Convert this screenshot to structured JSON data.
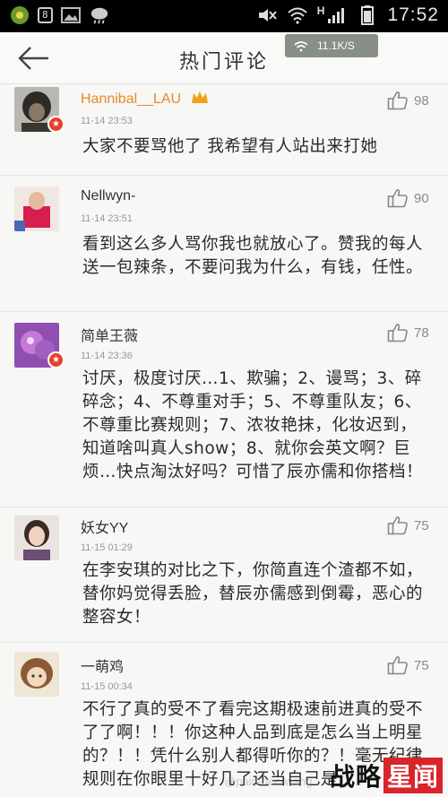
{
  "status_bar": {
    "battery_label": "8",
    "network_label": "H",
    "time": "17:52"
  },
  "header": {
    "title": "热门评论",
    "speed_toast": "11.1K/S"
  },
  "comments": [
    {
      "user": "Hannibal__LAU",
      "time": "11-14 23:53",
      "likes": "98",
      "text": "大家不要骂他了 我希望有人站出来打她"
    },
    {
      "user": "Nellwyn-",
      "time": "11-14 23:51",
      "likes": "90",
      "text": "看到这么多人骂你我也就放心了。赞我的每人送一包辣条，不要问我为什么，有钱，任性。"
    },
    {
      "user": "简单王薇",
      "time": "11-14 23:36",
      "likes": "78",
      "text": "讨厌，极度讨厌…1、欺骗；2、谩骂；3、碎碎念；4、不尊重对手；5、不尊重队友；6、不尊重比赛规则；7、浓妆艳抹，化妆迟到，知道啥叫真人show；8、就你会英文啊？巨烦…快点淘汰好吗？可惜了辰亦儒和你搭档！"
    },
    {
      "user": "妖女YY",
      "time": "11-15 01:29",
      "likes": "75",
      "text": "在李安琪的对比之下，你简直连个渣都不如，替你妈觉得丢脸，替辰亦儒感到倒霉，恶心的整容女！"
    },
    {
      "user": "一萌鸡",
      "time": "11-15 00:34",
      "likes": "75",
      "text": "不行了真的受不了看完这期极速前进真的受不了了啊！！！你这种人品到底是怎么当上明星的？！！凭什么别人都得听你的？！毫无纪律规则在你眼里十好几了还当自己是"
    }
  ],
  "watermark": {
    "logo_left": "战略",
    "logo_right": "星闻",
    "faint_text": "@pain-dec-wang"
  }
}
